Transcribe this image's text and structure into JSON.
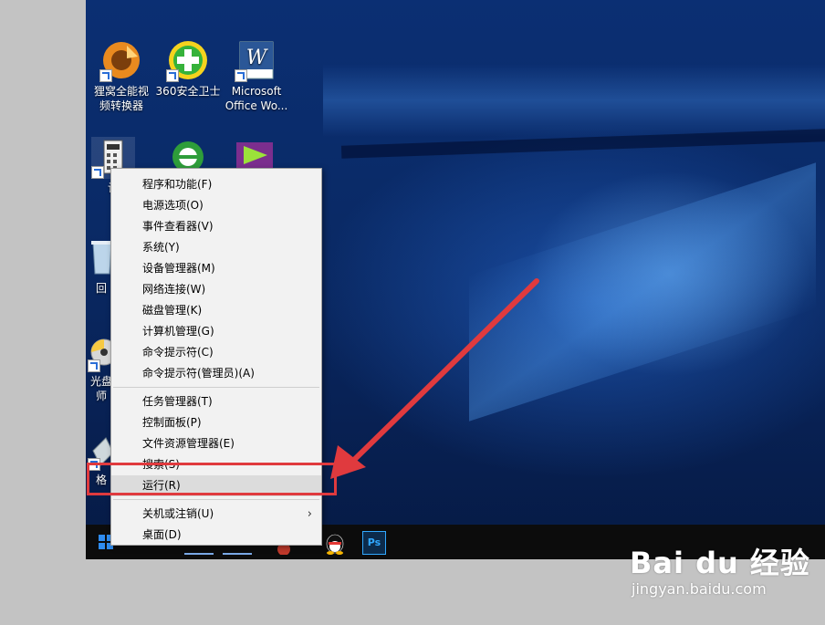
{
  "desktop": {
    "icons": [
      {
        "label": "狸窝全能视\n频转换器",
        "icon": "video-converter-icon"
      },
      {
        "label": "360安全卫士",
        "icon": "360-safe-icon"
      },
      {
        "label": "Microsoft\nOffice Wo...",
        "icon": "word-icon"
      },
      {
        "label": "计",
        "icon": "calculator-icon"
      },
      {
        "label": "回",
        "icon": "recycle-bin-icon"
      },
      {
        "label": "光盘\n师",
        "icon": "disc-icon"
      },
      {
        "label": "格",
        "icon": "format-icon"
      }
    ]
  },
  "context_menu": {
    "group1": [
      "程序和功能(F)",
      "电源选项(O)",
      "事件查看器(V)",
      "系统(Y)",
      "设备管理器(M)",
      "网络连接(W)",
      "磁盘管理(K)",
      "计算机管理(G)",
      "命令提示符(C)",
      "命令提示符(管理员)(A)"
    ],
    "group2": [
      "任务管理器(T)",
      "控制面板(P)",
      "文件资源管理器(E)",
      "搜索(S)",
      "运行(R)"
    ],
    "group3": [
      "关机或注销(U)",
      "桌面(D)"
    ],
    "submenu_arrow": "›",
    "highlighted_item": "运行(R)"
  },
  "taskbar": {
    "ps_label": "Ps",
    "qq_icon": "qq-penguin-icon"
  },
  "watermark": {
    "logo": "Bai du 经验",
    "url": "jingyan.baidu.com"
  },
  "colors": {
    "annotation_red": "#e03a3e",
    "menu_bg": "#f2f2f2",
    "menu_highlight": "#dcdcdc"
  }
}
